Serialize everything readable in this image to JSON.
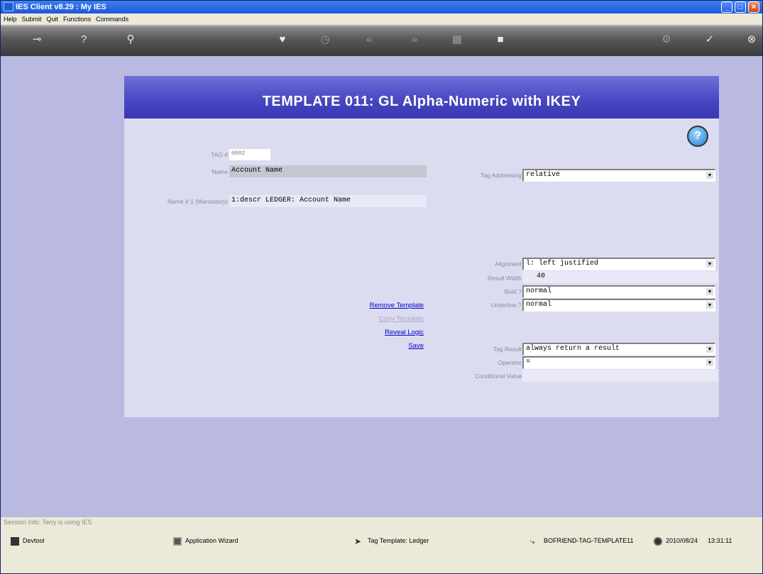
{
  "window": {
    "title": "IES Client v8.29 : My IES",
    "minimize": "_",
    "maximize": "□",
    "close": "×"
  },
  "menu": [
    "Help",
    "Submit",
    "Quit",
    "Functions",
    "Commands"
  ],
  "toolbar": {
    "icons": [
      "key-icon",
      "help-icon",
      "search-icon",
      "heart-icon",
      "clock-icon",
      "back-icon",
      "forward-icon",
      "grid-icon",
      "stop-icon",
      "settings-icon",
      "check-icon",
      "close-icon"
    ]
  },
  "template": {
    "title": "TEMPLATE 011: GL Alpha-Numeric with IKEY",
    "help_glyph": "?",
    "tag_label": "TAG #",
    "tag_value": "0002",
    "name_label": "Name",
    "name_value": "Account Name",
    "name1_label": "Name # 1 (Mandatory)",
    "name1_value": "1:descr LEDGER: Account Name",
    "tag_addressing_label": "Tag Addressing",
    "tag_addressing_value": "relative",
    "alignment_label": "Alignment",
    "alignment_value": "l: left justified",
    "result_width_label": "Result Width",
    "result_width_value": "40",
    "bold_label": "Bold ?",
    "bold_value": "normal",
    "underline_label": "Underline ?",
    "underline_value": "normal",
    "tag_result_label": "Tag Result",
    "tag_result_value": "always return a result",
    "operator_label": "Operator",
    "operator_value": "=",
    "conditional_value_label": "Conditional Value",
    "conditional_value": "",
    "links": {
      "remove": "Remove Template",
      "copy": "Copy Template",
      "reveal": "Reveal Logic",
      "save": "Save"
    }
  },
  "status": {
    "session": "Session Info: Terry is using IES",
    "devtool": "Devtool",
    "wizard": "Application Wizard",
    "tag_template": "Tag Template: Ledger",
    "frame": "BOFRIEND-TAG-TEMPLATE11",
    "date": "2010/08/24",
    "time": "13:31:11"
  }
}
